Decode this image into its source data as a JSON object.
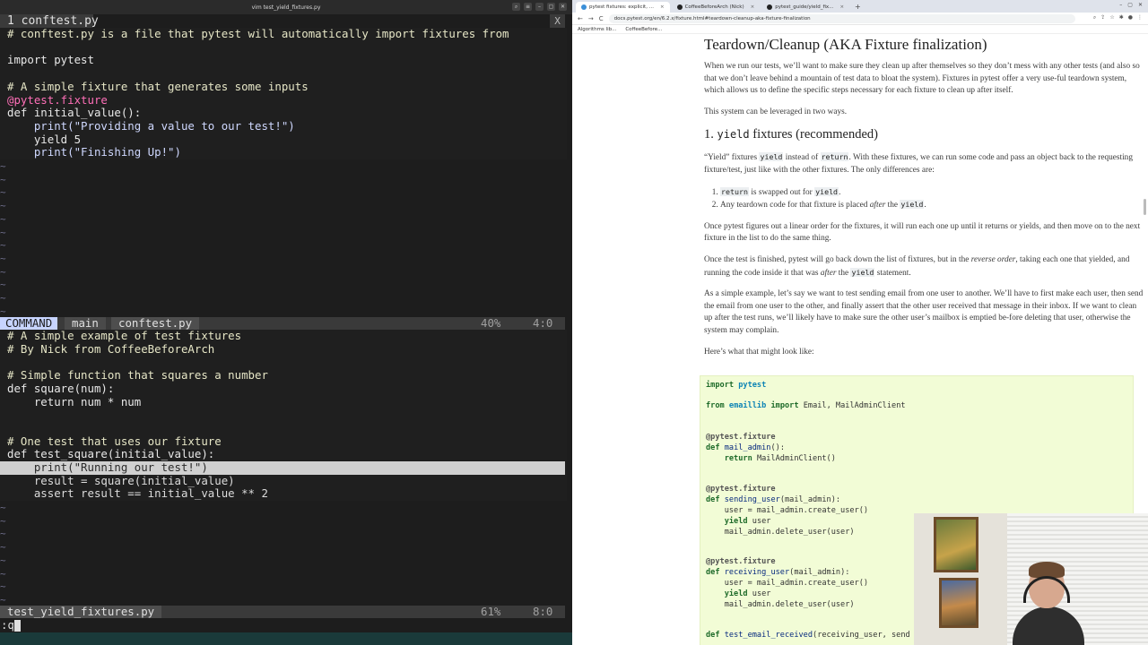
{
  "terminal": {
    "title": "vim test_yield_fixtures.py",
    "controls": [
      "⌕",
      "≡",
      "–",
      "▢",
      "✕"
    ],
    "tab_label": "1 conftest.py",
    "tab_close": "X",
    "top_pane": {
      "lines": [
        "# conftest.py is a file that pytest will automatically import fixtures from",
        "",
        "import pytest",
        "",
        "# A simple fixture that generates some inputs",
        "@pytest.fixture",
        "def initial_value():",
        "    print(\"Providing a value to our test!\")",
        "    yield 5",
        "    print(\"Finishing Up!\")"
      ],
      "tilde": "~"
    },
    "top_status": {
      "mode": "COMMAND",
      "branch": "main",
      "file": "conftest.py",
      "percent": "40%",
      "position": "4:0"
    },
    "bottom_pane": {
      "lines": [
        "# A simple example of test fixtures",
        "# By Nick from CoffeeBeforeArch",
        "",
        "# Simple function that squares a number",
        "def square(num):",
        "    return num * num",
        "",
        "",
        "# One test that uses our fixture",
        "def test_square(initial_value):",
        "    print(\"Running our test!\")",
        "    result = square(initial_value)",
        "    assert result == initial_value ** 2"
      ],
      "tilde": "~"
    },
    "bottom_status": {
      "file": "test_yield_fixtures.py",
      "percent": "61%",
      "position": "8:0"
    },
    "command_line": ":q"
  },
  "browser": {
    "tabs": [
      {
        "label": "pytest fixtures: explicit, ...",
        "active": true
      },
      {
        "label": "CoffeeBeforeArch (Nick)",
        "active": false
      },
      {
        "label": "pytest_guide/yield_fix...",
        "active": false
      }
    ],
    "new_tab": "+",
    "window_controls": [
      "–",
      "▢",
      "✕"
    ],
    "nav": {
      "back": "←",
      "forward": "→",
      "reload": "C"
    },
    "url": "docs.pytest.org/en/6.2.x/fixture.html#teardown-cleanup-aka-fixture-finalization",
    "bookmarks": [
      "Algorithms lib...",
      "CoffeeBefore..."
    ],
    "doc": {
      "h1": "Teardown/Cleanup (AKA Fixture finalization)",
      "p1": "When we run our tests, we’ll want to make sure they clean up after themselves so they don’t mess with any other tests (and also so that we don’t leave behind a mountain of test data to bloat the system). Fixtures in pytest offer a very use-ful teardown system, which allows us to define the specific steps necessary for each fixture to clean up after itself.",
      "p2": "This system can be leveraged in two ways.",
      "h2_num": "1.",
      "h2_code": "yield",
      "h2_text": "fixtures (recommended)",
      "p3_a": "“Yield” fixtures",
      "p3_code1": "yield",
      "p3_b": "instead of",
      "p3_code2": "return",
      "p3_c": ". With these fixtures, we can run some code and pass an object back to the requesting fixture/test, just like with the other fixtures. The only differences are:",
      "li1_code1": "return",
      "li1_text": "is swapped out for",
      "li1_code2": "yield",
      "li1_end": ".",
      "li2_text": "Any teardown code for that fixture is placed",
      "li2_em": "after",
      "li2_text2": "the",
      "li2_code": "yield",
      "li2_end": ".",
      "p4": "Once pytest figures out a linear order for the fixtures, it will run each one up until it returns or yields, and then move on to the next fixture in the list to do the same thing.",
      "p5_a": "Once the test is finished, pytest will go back down the list of fixtures, but in the",
      "p5_em": "reverse order",
      "p5_b": ", taking each one that yielded, and running the code inside it that was",
      "p5_em2": "after",
      "p5_c": "the",
      "p5_code": "yield",
      "p5_d": "statement.",
      "p6": "As a simple example, let’s say we want to test sending email from one user to another. We’ll have to first make each user, then send the email from one user to the other, and finally assert that the other user received that message in their inbox. If we want to clean up after the test runs, we’ll likely have to make sure the other user’s mailbox is emptied be-fore deleting that user, otherwise the system may complain.",
      "p7": "Here’s what that might look like:",
      "code": {
        "l1_kw": "import",
        "l1_mod": "pytest",
        "l2_kw1": "from",
        "l2_mod": "emaillib",
        "l2_kw2": "import",
        "l2_rest": "Email, MailAdminClient",
        "l3": "@pytest.fixture",
        "l4_kw": "def",
        "l4_name": "mail_admin",
        "l4_rest": "():",
        "l5_kw": "return",
        "l5_rest": "MailAdminClient()",
        "l6": "@pytest.fixture",
        "l7_kw": "def",
        "l7_name": "sending_user",
        "l7_rest": "(mail_admin):",
        "l8": "    user = mail_admin.create_user()",
        "l9_kw": "yield",
        "l9_rest": "user",
        "l10": "    mail_admin.delete_user(user)",
        "l11": "@pytest.fixture",
        "l12_kw": "def",
        "l12_name": "receiving_user",
        "l12_rest": "(mail_admin):",
        "l13": "    user = mail_admin.create_user()",
        "l14_kw": "yield",
        "l14_rest": "user",
        "l15": "    mail_admin.delete_user(user)",
        "l16_kw": "def",
        "l16_name": "test_email_received",
        "l16_rest": "(receiving_user, send"
      }
    }
  }
}
